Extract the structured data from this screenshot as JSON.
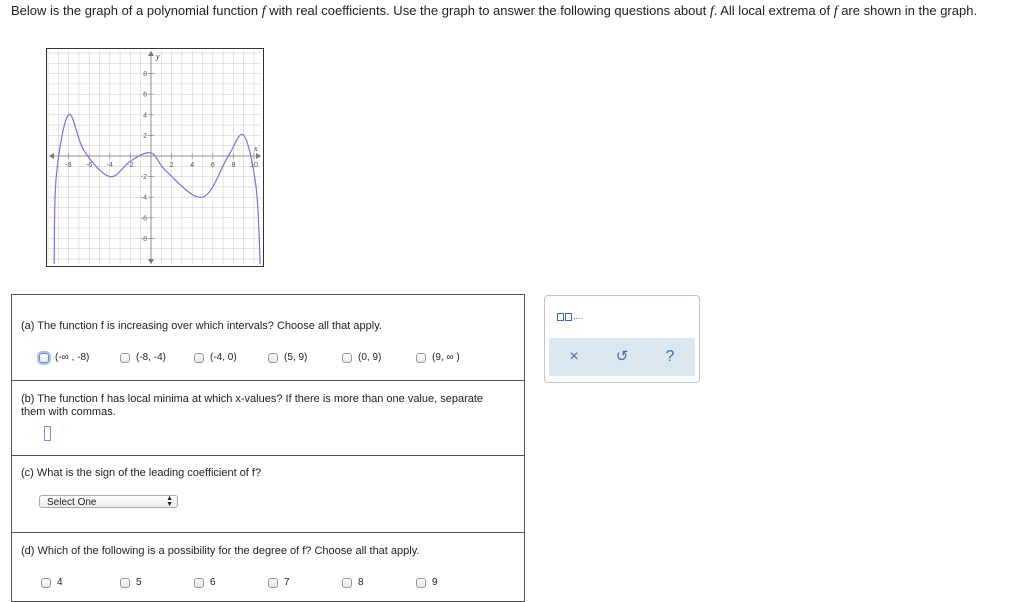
{
  "intro": {
    "p1": "Below is the graph of a polynomial function ",
    "f1": "f",
    "p2": " with real coefficients. Use the graph to answer the following questions about ",
    "f2": "f",
    "p3": ". All local extrema of ",
    "f3": "f",
    "p4": " are shown in the graph."
  },
  "graph": {
    "x_label": "x",
    "y_label": "y",
    "x_ticks": [
      "-8",
      "-6",
      "-4",
      "-2",
      "2",
      "4",
      "6",
      "8",
      "10"
    ],
    "y_ticks": [
      "8",
      "6",
      "4",
      "2",
      "-2",
      "-4",
      "-6",
      "-8"
    ],
    "grid_color": "#c8c8c8",
    "curve_color": "#7272f0",
    "curve_points": [
      [
        -9.4,
        -10.5
      ],
      [
        -9.2,
        -2
      ],
      [
        -8,
        4
      ],
      [
        -6.5,
        0.5
      ],
      [
        -4,
        -2
      ],
      [
        -2,
        -0.5
      ],
      [
        0,
        0.3
      ],
      [
        1.5,
        -1.5
      ],
      [
        5,
        -4
      ],
      [
        7.5,
        0
      ],
      [
        9,
        2
      ],
      [
        10.2,
        -3
      ],
      [
        10.6,
        -10.5
      ]
    ]
  },
  "qa": {
    "question": "(a) The function f is increasing over which intervals? Choose all that apply.",
    "options": [
      "(-∞ , -8)",
      "(-8, -4)",
      "(-4, 0)",
      "(5, 9)",
      "(0, 9)",
      "(9, ∞ )"
    ]
  },
  "qb": {
    "question": "(b) The function f has local minima at which x-values? If there is more than one value, separate them with commas."
  },
  "qc": {
    "question": "(c) What is the sign of the leading coefficient of f?",
    "select_value": "Select One"
  },
  "qd": {
    "question": "(d) Which of the following is a possibility for the degree of f? Choose all that apply.",
    "options": [
      "4",
      "5",
      "6",
      "7",
      "8",
      "9"
    ]
  },
  "tools": {
    "ellipsis": ",...",
    "clear": "×",
    "undo": "↺",
    "help": "?"
  }
}
